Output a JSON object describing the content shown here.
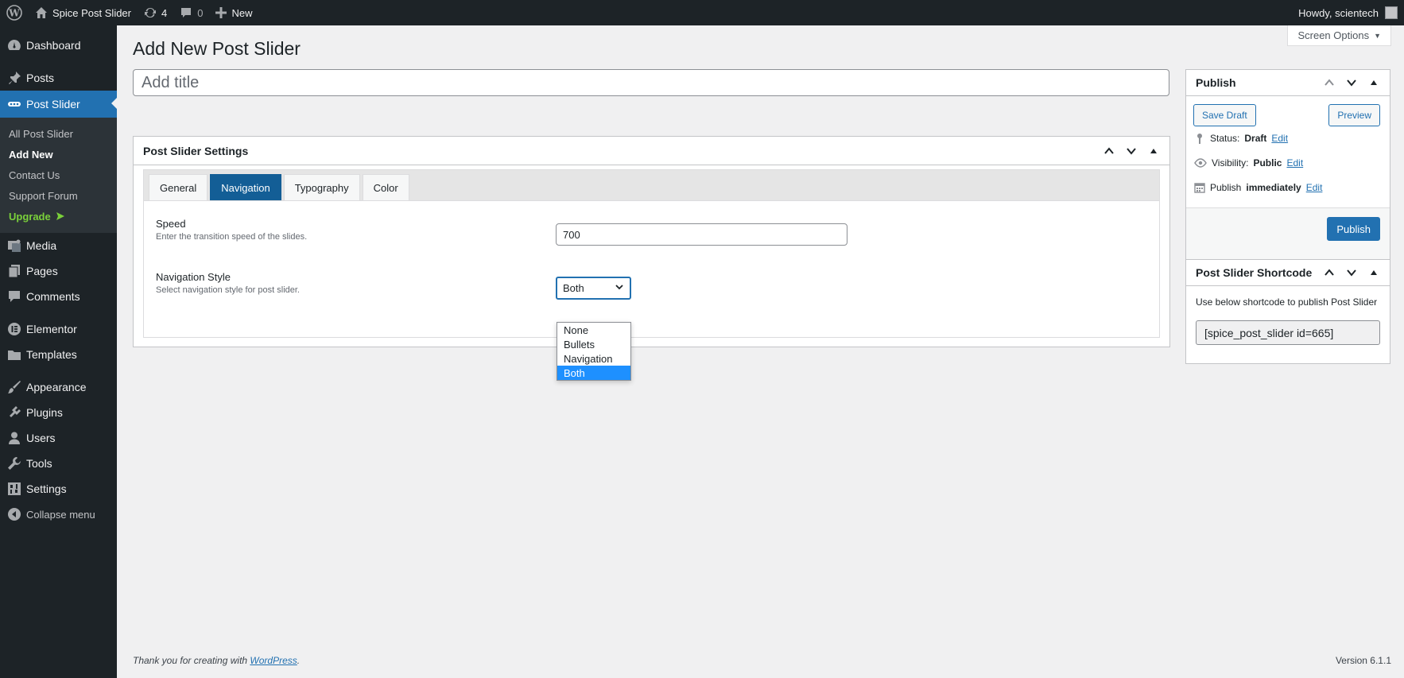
{
  "admin_bar": {
    "site_name": "Spice Post Slider",
    "updates_count": "4",
    "comments_count": "0",
    "new_label": "New",
    "howdy": "Howdy, scientech"
  },
  "sidebar": {
    "items": [
      {
        "label": "Dashboard",
        "icon": "dashboard-icon"
      },
      {
        "label": "Posts",
        "icon": "pin-icon"
      },
      {
        "label": "Post Slider",
        "icon": "slider-icon"
      },
      {
        "label": "Media",
        "icon": "media-icon"
      },
      {
        "label": "Pages",
        "icon": "pages-icon"
      },
      {
        "label": "Comments",
        "icon": "comments-icon"
      },
      {
        "label": "Elementor",
        "icon": "elementor-icon"
      },
      {
        "label": "Templates",
        "icon": "folder-icon"
      },
      {
        "label": "Appearance",
        "icon": "brush-icon"
      },
      {
        "label": "Plugins",
        "icon": "plugin-icon"
      },
      {
        "label": "Users",
        "icon": "user-icon"
      },
      {
        "label": "Tools",
        "icon": "wrench-icon"
      },
      {
        "label": "Settings",
        "icon": "settings-icon"
      },
      {
        "label": "Collapse menu",
        "icon": "collapse-icon"
      }
    ],
    "submenu": [
      "All Post Slider",
      "Add New",
      "Contact Us",
      "Support Forum",
      "Upgrade"
    ]
  },
  "screen_options": "Screen Options",
  "page_title": "Add New Post Slider",
  "title_placeholder": "Add title",
  "settings": {
    "header": "Post Slider Settings",
    "tabs": [
      "General",
      "Navigation",
      "Typography",
      "Color"
    ],
    "active_tab": "Navigation",
    "speed_label": "Speed",
    "speed_desc": "Enter the transition speed of the slides.",
    "speed_value": "700",
    "nav_label": "Navigation Style",
    "nav_desc": "Select navigation style for post slider.",
    "nav_value": "Both",
    "nav_options": [
      "None",
      "Bullets",
      "Navigation",
      "Both"
    ]
  },
  "publish": {
    "header": "Publish",
    "save_draft": "Save Draft",
    "preview": "Preview",
    "status_label": "Status:",
    "status_value": "Draft",
    "visibility_label": "Visibility:",
    "visibility_value": "Public",
    "publish_label": "Publish",
    "publish_value": "immediately",
    "edit": "Edit",
    "publish_button": "Publish"
  },
  "shortcode": {
    "header": "Post Slider Shortcode",
    "desc": "Use below shortcode to publish Post Slider",
    "value": "[spice_post_slider id=665]"
  },
  "footer": {
    "thanks_prefix": "Thank you for creating with",
    "thanks_link": "WordPress",
    "thanks_suffix": ".",
    "version": "Version 6.1.1"
  },
  "colors": {
    "admin_dark": "#1d2327",
    "accent": "#2271b1",
    "upgrade": "#7ad03a"
  }
}
